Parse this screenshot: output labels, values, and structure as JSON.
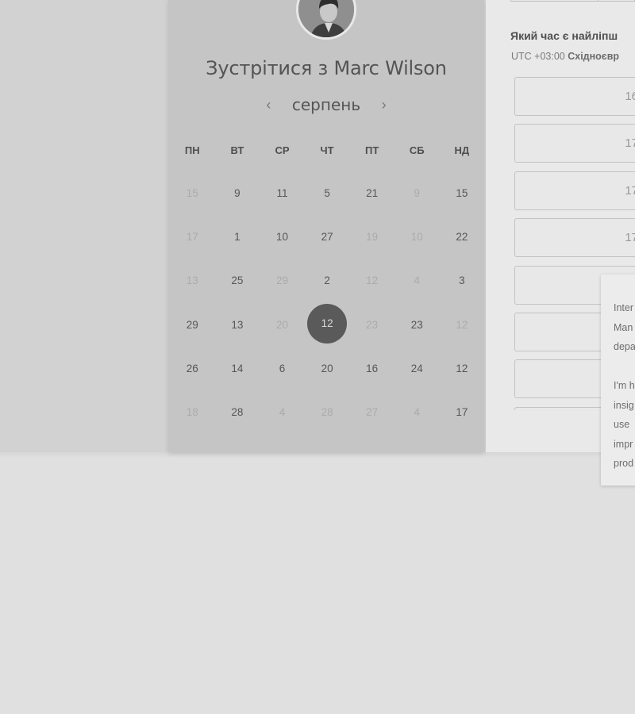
{
  "host": {
    "title_prefix": "Зустрітися з",
    "name": "Marc Wilson"
  },
  "calendar": {
    "month": "серпень",
    "prev_icon": "chevron-left-icon",
    "next_icon": "chevron-right-icon",
    "weekdays": [
      "ПН",
      "ВТ",
      "СР",
      "ЧТ",
      "ПТ",
      "СБ",
      "НД"
    ],
    "weeks": [
      [
        {
          "d": "15",
          "m": true
        },
        {
          "d": "9",
          "m": false
        },
        {
          "d": "11",
          "m": false
        },
        {
          "d": "5",
          "m": false
        },
        {
          "d": "21",
          "m": false
        },
        {
          "d": "9",
          "m": true
        },
        {
          "d": "15",
          "m": false
        }
      ],
      [
        {
          "d": "17",
          "m": true
        },
        {
          "d": "1",
          "m": false
        },
        {
          "d": "10",
          "m": false
        },
        {
          "d": "27",
          "m": false
        },
        {
          "d": "19",
          "m": true
        },
        {
          "d": "10",
          "m": true
        },
        {
          "d": "22",
          "m": false
        }
      ],
      [
        {
          "d": "13",
          "m": true
        },
        {
          "d": "25",
          "m": false
        },
        {
          "d": "29",
          "m": true
        },
        {
          "d": "2",
          "m": false
        },
        {
          "d": "12",
          "m": true
        },
        {
          "d": "4",
          "m": true
        },
        {
          "d": "3",
          "m": false
        }
      ],
      [
        {
          "d": "29",
          "m": false
        },
        {
          "d": "13",
          "m": false
        },
        {
          "d": "20",
          "m": true
        },
        {
          "d": "12",
          "m": false,
          "sel": true
        },
        {
          "d": "23",
          "m": true
        },
        {
          "d": "23",
          "m": false
        },
        {
          "d": "12",
          "m": true
        }
      ],
      [
        {
          "d": "26",
          "m": false
        },
        {
          "d": "14",
          "m": false
        },
        {
          "d": "6",
          "m": false
        },
        {
          "d": "20",
          "m": false
        },
        {
          "d": "16",
          "m": false
        },
        {
          "d": "24",
          "m": false
        },
        {
          "d": "12",
          "m": false
        }
      ],
      [
        {
          "d": "18",
          "m": true
        },
        {
          "d": "28",
          "m": false
        },
        {
          "d": "4",
          "m": true
        },
        {
          "d": "28",
          "m": true
        },
        {
          "d": "27",
          "m": true
        },
        {
          "d": "4",
          "m": true
        },
        {
          "d": "17",
          "m": false
        }
      ]
    ]
  },
  "times": {
    "question": "Який час є найліпш",
    "tz_offset": "UTC +03:00",
    "tz_name": "Східноєвр",
    "slots": [
      "16",
      "17",
      "17",
      "17",
      "",
      "",
      "",
      ""
    ]
  },
  "tooltip": {
    "lines": [
      "Inter",
      "Man",
      "depa",
      "",
      "I'm h",
      "insig",
      "use",
      "impr",
      "prod"
    ]
  },
  "colors": {
    "selected": "#5a5a5a",
    "panel": "#c5c5c5",
    "background": "#e0e0e0"
  }
}
